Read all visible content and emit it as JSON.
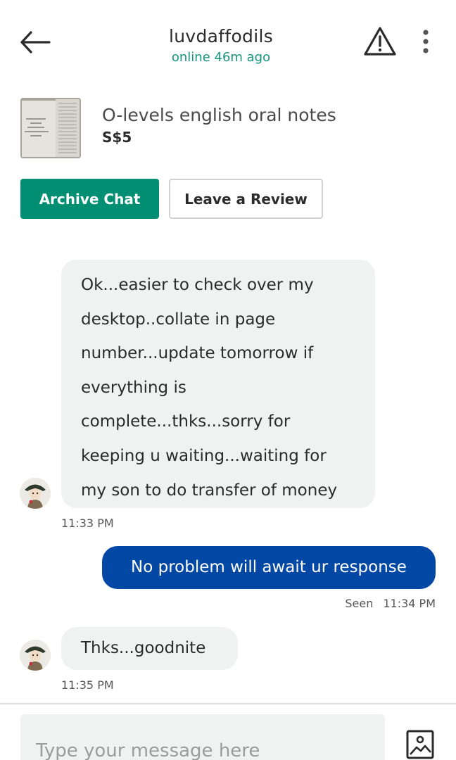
{
  "header": {
    "back_icon": "arrow-left-icon",
    "username": "luvdaffodils",
    "status": "online 46m ago",
    "status_color": "#16947d",
    "report_icon": "warning-triangle-icon",
    "more_icon": "more-vertical-icon"
  },
  "listing": {
    "title": "O-levels english oral notes",
    "price": "S$5",
    "thumbnail_icon": "notes-photo-thumbnail"
  },
  "actions": {
    "archive_label": "Archive Chat",
    "archive_color": "#008f73",
    "review_label": "Leave a Review"
  },
  "messages": [
    {
      "direction": "incoming",
      "lines": [
        "Ok...easier to check over my",
        "desktop..collate in page",
        "number...update tomorrow if",
        "everything is",
        "complete...thks...sorry for",
        "keeping u waiting...waiting for",
        "my son to do transfer of money"
      ],
      "time": "11:33 PM"
    },
    {
      "direction": "outgoing",
      "text": "No problem will await ur response",
      "seen_label": "Seen",
      "time": "11:34 PM",
      "bubble_color": "#0348a4"
    },
    {
      "direction": "incoming",
      "text": "Thks...goodnite",
      "time": "11:35 PM"
    }
  ],
  "composer": {
    "placeholder": "Type your message here",
    "image_icon": "image-upload-icon"
  }
}
